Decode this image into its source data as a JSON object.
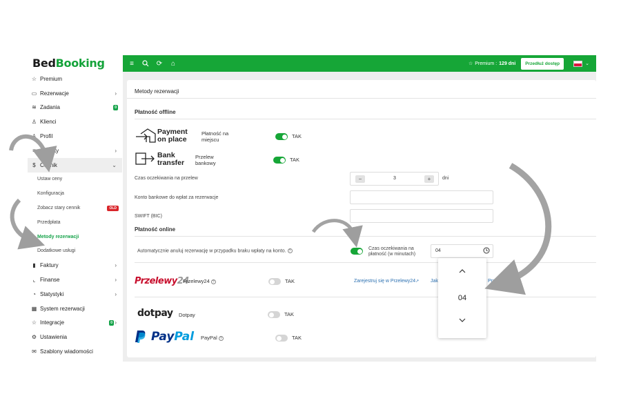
{
  "brand": {
    "bed": "Bed",
    "booking": "Booking"
  },
  "sidebar": {
    "items": [
      {
        "icon": "☆",
        "label": "Premium"
      },
      {
        "icon": "▭",
        "label": "Rezerwacje",
        "chev": "›"
      },
      {
        "icon": "≋",
        "label": "Zadania",
        "badge": "0"
      },
      {
        "icon": "♙",
        "label": "Klienci"
      },
      {
        "icon": "♙",
        "label": "Profil"
      },
      {
        "icon": "≡",
        "label": "Obiekty",
        "chev": "›"
      },
      {
        "icon": "$",
        "label": "Cennik",
        "chev": "⌄"
      }
    ],
    "sub": [
      "Ustaw ceny",
      "Konfiguracja",
      "Zobacz stary cennik",
      "Przedpłata",
      "Metody rezerwacji",
      "Dodatkowe usługi"
    ],
    "old_badge": "OLD",
    "items2": [
      {
        "icon": "▮",
        "label": "Faktury",
        "chev": "›"
      },
      {
        "icon": "⌞",
        "label": "Finanse",
        "chev": "›"
      },
      {
        "icon": "◔",
        "label": "Statystyki",
        "chev": "›"
      },
      {
        "icon": "▦",
        "label": "System rezerwacji"
      },
      {
        "icon": "☆",
        "label": "Integracje",
        "badge": "0",
        "chev": "›"
      },
      {
        "icon": "⚙",
        "label": "Ustawienia"
      },
      {
        "icon": "✉",
        "label": "Szablony wiadomości"
      }
    ]
  },
  "topbar": {
    "premium_label": "Premium :",
    "premium_days": "129 dni",
    "extend_label": "Przedłuż dostęp"
  },
  "page": {
    "title": "Metody rezerwacji",
    "offline_title": "Płatność offline",
    "online_title": "Płatność online",
    "pay_on_place": {
      "line1": "Payment",
      "line2": "on place",
      "label1": "Płatność na",
      "label2": "miejscu",
      "tak": "TAK"
    },
    "bank": {
      "line1": "Bank",
      "line2": "transfer",
      "label1": "Przelew",
      "label2": "bankowy",
      "tak": "TAK"
    },
    "wait_label": "Czas oczekiwania na przelew",
    "wait_value": "3",
    "wait_unit": "dni",
    "minus": "−",
    "plus": "+",
    "account_label": "Konto bankowe do wpłat za rezerwacje",
    "swift_label": "SWIFT (BIC)",
    "auto_cancel_label": "Automatycznie anuluj rezerwację w przypadku braku wpłaty na konto.",
    "wait_min_label1": "Czas oczekiwania na",
    "wait_min_label2": "płatność (w minutach)",
    "wait_min_value": "04",
    "przelewy": {
      "logo1": "Przelewy",
      "logo2": "24",
      "name": "Przelewy24",
      "tak": "TAK",
      "link1": "Zarejestruj się w Przelewy24",
      "link2": "Jak",
      "link3": "Przel"
    },
    "dotpay": {
      "logo": "dotpay",
      "name": "Dotpay",
      "tak": "TAK"
    },
    "paypal": {
      "logo1": "Pay",
      "logo2": "Pal",
      "name": "PayPal",
      "tak": "TAK"
    },
    "dropdown_value": "04"
  },
  "colors": {
    "accent": "#16a637",
    "link": "#2a6fb0",
    "old": "#d9252a"
  }
}
